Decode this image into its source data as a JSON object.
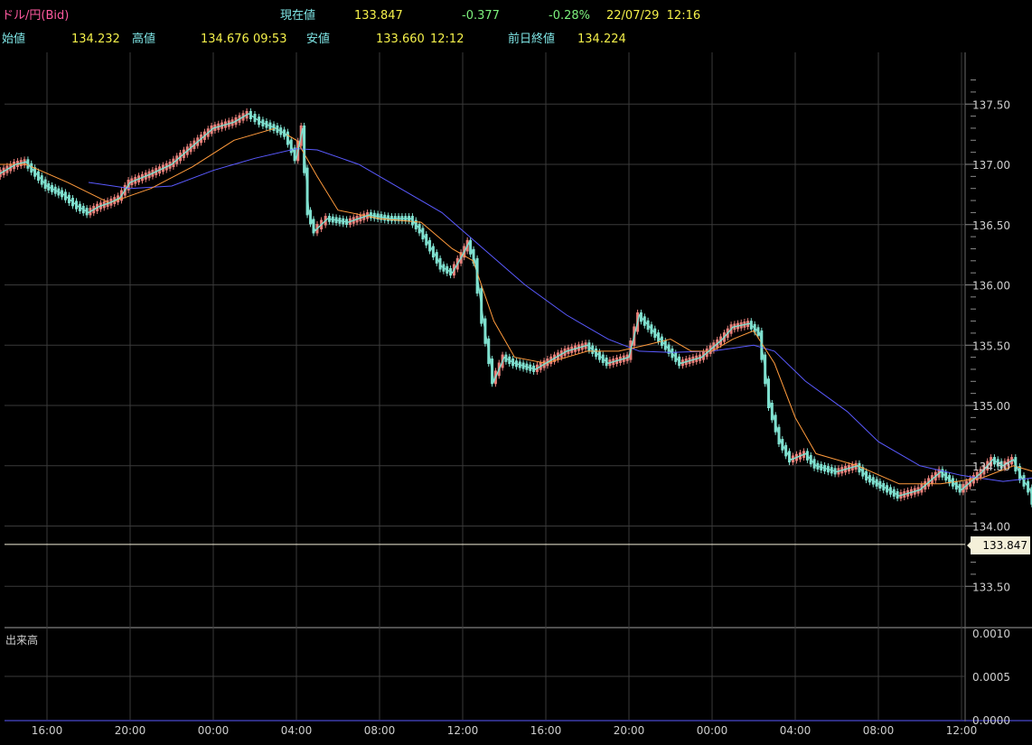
{
  "header": {
    "instrument": "ドル/円(Bid)",
    "current_label": "現在値",
    "current_value": "133.847",
    "change": "-0.377",
    "change_pct": "-0.28%",
    "datetime": "22/07/29  12:16",
    "open_label": "始値",
    "open_value": "134.232",
    "high_label": "高値",
    "high_value": "134.676",
    "high_time": "09:53",
    "low_label": "安値",
    "low_value": "133.660",
    "low_time": "12:12",
    "prev_close_label": "前日終値",
    "prev_close_value": "134.224"
  },
  "volume_panel": {
    "title": "出来高",
    "tick_labels": [
      "0.0010",
      "0.0005",
      "0.0000"
    ]
  },
  "current_price_tag": "133.847",
  "colors": {
    "background": "#000000",
    "grid": "#3a3a3a",
    "up_candle": "#e8807a",
    "down_candle": "#7fe0cf",
    "ma_short": "#ff9a3c",
    "ma_long": "#5a5aff",
    "instrument_title": "#ff5aa0",
    "labels": "#7fe6e6",
    "values": "#f4f04a",
    "negative_change": "#7cf07c"
  },
  "chart_data": {
    "type": "line",
    "title": "ドル/円(Bid)",
    "xlabel": "",
    "ylabel": "",
    "x_ticks": [
      "16:00",
      "20:00",
      "00:00",
      "04:00",
      "08:00",
      "12:00",
      "16:00",
      "20:00",
      "00:00",
      "04:00",
      "08:00",
      "12:00"
    ],
    "y_ticks": [
      "133.50",
      "134.00",
      "134.50",
      "135.00",
      "135.50",
      "136.00",
      "136.50",
      "137.00",
      "137.50"
    ],
    "ylim": [
      133.3,
      137.8
    ],
    "xlim": [
      -4.2,
      42.1
    ],
    "grid": true,
    "current_price": 133.847,
    "price_points": [
      [
        -4.1,
        137.0
      ],
      [
        -3.0,
        136.95
      ],
      [
        -2.5,
        136.9
      ],
      [
        -1.5,
        137.0
      ],
      [
        -1.0,
        137.02
      ],
      [
        0.0,
        136.82
      ],
      [
        0.8,
        136.75
      ],
      [
        1.5,
        136.65
      ],
      [
        2.0,
        136.6
      ],
      [
        2.5,
        136.65
      ],
      [
        3.0,
        136.68
      ],
      [
        3.5,
        136.72
      ],
      [
        4.0,
        136.85
      ],
      [
        5.0,
        136.92
      ],
      [
        6.0,
        137.0
      ],
      [
        7.0,
        137.15
      ],
      [
        8.0,
        137.3
      ],
      [
        9.0,
        137.35
      ],
      [
        9.7,
        137.42
      ],
      [
        10.3,
        137.35
      ],
      [
        11.0,
        137.3
      ],
      [
        11.5,
        137.25
      ],
      [
        12.0,
        137.05
      ],
      [
        12.3,
        137.3
      ],
      [
        12.6,
        136.6
      ],
      [
        12.9,
        136.45
      ],
      [
        13.5,
        136.55
      ],
      [
        14.5,
        136.52
      ],
      [
        15.5,
        136.58
      ],
      [
        16.5,
        136.55
      ],
      [
        17.5,
        136.55
      ],
      [
        18.0,
        136.45
      ],
      [
        18.5,
        136.3
      ],
      [
        19.0,
        136.15
      ],
      [
        19.5,
        136.1
      ],
      [
        20.0,
        136.25
      ],
      [
        20.3,
        136.35
      ],
      [
        20.6,
        136.2
      ],
      [
        21.0,
        135.7
      ],
      [
        21.5,
        135.2
      ],
      [
        22.0,
        135.4
      ],
      [
        22.5,
        135.35
      ],
      [
        23.5,
        135.3
      ],
      [
        24.0,
        135.35
      ],
      [
        25.0,
        135.45
      ],
      [
        26.0,
        135.5
      ],
      [
        27.0,
        135.35
      ],
      [
        28.0,
        135.4
      ],
      [
        28.5,
        135.75
      ],
      [
        29.0,
        135.65
      ],
      [
        30.0,
        135.45
      ],
      [
        30.5,
        135.35
      ],
      [
        31.5,
        135.4
      ],
      [
        32.5,
        135.55
      ],
      [
        33.0,
        135.65
      ],
      [
        33.8,
        135.68
      ],
      [
        34.3,
        135.6
      ],
      [
        34.8,
        135.0
      ],
      [
        35.3,
        134.7
      ],
      [
        35.8,
        134.55
      ],
      [
        36.5,
        134.6
      ],
      [
        37.0,
        134.5
      ],
      [
        38.0,
        134.45
      ],
      [
        39.0,
        134.5
      ],
      [
        39.5,
        134.4
      ],
      [
        40.0,
        134.35
      ],
      [
        41.0,
        134.25
      ],
      [
        42.0,
        134.3
      ],
      [
        43.0,
        134.45
      ],
      [
        44.0,
        134.3
      ],
      [
        45.0,
        134.45
      ],
      [
        45.5,
        134.55
      ],
      [
        46.0,
        134.5
      ],
      [
        46.5,
        134.55
      ],
      [
        46.9,
        134.4
      ],
      [
        47.3,
        134.3
      ],
      [
        47.8,
        134.0
      ],
      [
        48.0,
        133.85
      ]
    ],
    "ma_short": [
      [
        -4.1,
        137.0
      ],
      [
        -1.0,
        137.0
      ],
      [
        1.0,
        136.85
      ],
      [
        3.0,
        136.68
      ],
      [
        5.0,
        136.8
      ],
      [
        7.0,
        136.98
      ],
      [
        9.0,
        137.2
      ],
      [
        11.0,
        137.3
      ],
      [
        12.0,
        137.2
      ],
      [
        13.0,
        136.9
      ],
      [
        14.0,
        136.62
      ],
      [
        16.0,
        136.55
      ],
      [
        18.0,
        136.52
      ],
      [
        19.5,
        136.3
      ],
      [
        20.5,
        136.2
      ],
      [
        21.5,
        135.7
      ],
      [
        22.5,
        135.4
      ],
      [
        24.0,
        135.35
      ],
      [
        26.0,
        135.45
      ],
      [
        27.5,
        135.45
      ],
      [
        28.8,
        135.5
      ],
      [
        30.0,
        135.55
      ],
      [
        31.0,
        135.45
      ],
      [
        32.0,
        135.45
      ],
      [
        33.0,
        135.55
      ],
      [
        34.0,
        135.62
      ],
      [
        35.0,
        135.35
      ],
      [
        36.0,
        134.9
      ],
      [
        37.0,
        134.6
      ],
      [
        39.0,
        134.5
      ],
      [
        41.0,
        134.35
      ],
      [
        43.0,
        134.35
      ],
      [
        45.0,
        134.4
      ],
      [
        46.5,
        134.5
      ],
      [
        47.5,
        134.45
      ],
      [
        48.0,
        134.35
      ]
    ],
    "ma_long": [
      [
        2.0,
        136.85
      ],
      [
        4.0,
        136.8
      ],
      [
        6.0,
        136.82
      ],
      [
        8.0,
        136.95
      ],
      [
        10.0,
        137.05
      ],
      [
        12.0,
        137.13
      ],
      [
        13.0,
        137.12
      ],
      [
        15.0,
        137.0
      ],
      [
        17.0,
        136.8
      ],
      [
        19.0,
        136.6
      ],
      [
        21.0,
        136.3
      ],
      [
        23.0,
        136.0
      ],
      [
        25.0,
        135.75
      ],
      [
        27.0,
        135.55
      ],
      [
        28.5,
        135.45
      ],
      [
        30.0,
        135.44
      ],
      [
        32.0,
        135.45
      ],
      [
        34.0,
        135.5
      ],
      [
        35.0,
        135.45
      ],
      [
        36.5,
        135.2
      ],
      [
        38.5,
        134.95
      ],
      [
        40.0,
        134.7
      ],
      [
        42.0,
        134.5
      ],
      [
        44.0,
        134.42
      ],
      [
        46.0,
        134.37
      ],
      [
        47.5,
        134.4
      ],
      [
        48.0,
        134.38
      ]
    ]
  }
}
